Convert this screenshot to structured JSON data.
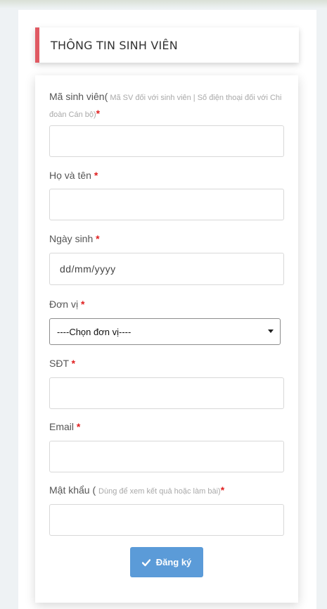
{
  "header": {
    "title": "THÔNG TIN SINH VIÊN"
  },
  "colors": {
    "accent": "#e05a63",
    "button": "#5b9bd8",
    "required": "#e02020"
  },
  "fields": {
    "student_id": {
      "label": "Mã sinh viên(",
      "hint": " Mã SV đối với sinh viên | Số điện thoại đối với Chi đoàn Cán bộ)",
      "required_mark": "*",
      "value": ""
    },
    "full_name": {
      "label": "Họ và tên ",
      "required_mark": "*",
      "value": ""
    },
    "birth_date": {
      "label": "Ngày sinh ",
      "required_mark": "*",
      "placeholder": "dd/mm/yyyy"
    },
    "unit": {
      "label": "Đơn vị ",
      "required_mark": "*",
      "selected": "----Chọn đơn vị----"
    },
    "phone": {
      "label": "SĐT ",
      "required_mark": "*",
      "value": ""
    },
    "email": {
      "label": "Email ",
      "required_mark": "*",
      "value": ""
    },
    "password": {
      "label": "Mật khẩu ( ",
      "hint": "Dùng để xem kết quả hoặc làm bài)",
      "required_mark": "*",
      "value": ""
    }
  },
  "submit": {
    "icon": "check-icon",
    "label": "Đăng ký"
  }
}
